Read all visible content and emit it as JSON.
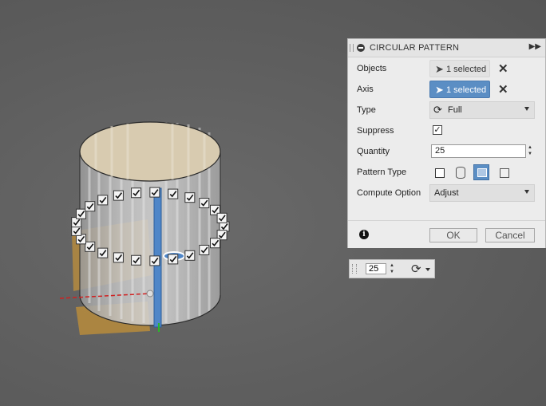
{
  "panel": {
    "title": "CIRCULAR PATTERN",
    "objects_label": "Objects",
    "objects_value": "1 selected",
    "axis_label": "Axis",
    "axis_value": "1 selected",
    "type_label": "Type",
    "type_value": "Full",
    "suppress_label": "Suppress",
    "suppress_checked": true,
    "quantity_label": "Quantity",
    "quantity_value": "25",
    "pattern_type_label": "Pattern Type",
    "compute_label": "Compute Option",
    "compute_value": "Adjust",
    "ok_label": "OK",
    "cancel_label": "Cancel"
  },
  "mini_toolbar": {
    "quantity_value": "25"
  },
  "colors": {
    "accent": "#5b8ec4",
    "background": "#5f5f5f",
    "panel_bg": "#ececec"
  },
  "icons": [
    "minus-circle-icon",
    "expand-arrows-icon",
    "cursor-arrow-icon",
    "close-icon",
    "rotate-icon",
    "info-icon",
    "checkmark-icon"
  ]
}
